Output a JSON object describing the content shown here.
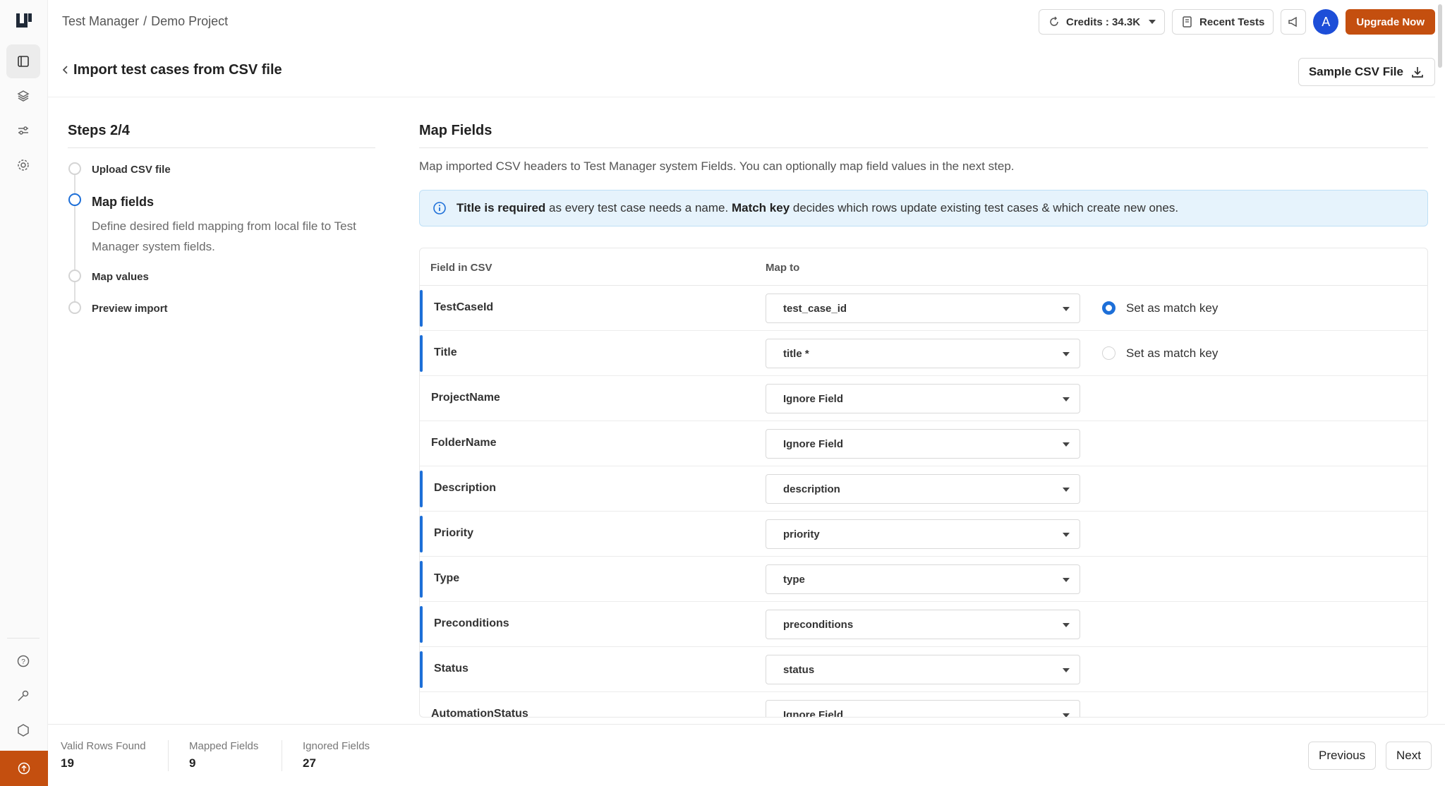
{
  "breadcrumb": {
    "app": "Test Manager",
    "separator": "/",
    "project": "Demo Project"
  },
  "topbar": {
    "credits": "Credits : 34.3K",
    "recent_tests": "Recent Tests",
    "avatar_initial": "A",
    "upgrade": "Upgrade Now"
  },
  "page": {
    "title": "Import test cases from CSV file",
    "sample_button": "Sample CSV File"
  },
  "steps": {
    "title": "Steps 2/4",
    "items": [
      {
        "label": "Upload CSV file"
      },
      {
        "label": "Map fields",
        "description": "Define desired field mapping from local file to Test Manager system fields."
      },
      {
        "label": "Map values"
      },
      {
        "label": "Preview import"
      }
    ]
  },
  "map": {
    "title": "Map Fields",
    "description": "Map imported CSV headers to Test Manager system Fields. You can optionally map field values in the next step.",
    "info": {
      "bold1": "Title is required",
      "text1": "as every test case needs a name.",
      "bold2": "Match key",
      "text2": "decides which rows update existing test cases & which create new ones."
    },
    "headers": {
      "field": "Field in CSV",
      "map_to": "Map to"
    },
    "match_key_label": "Set as match key",
    "rows": [
      {
        "field": "TestCaseId",
        "map_to": "test_case_id"
      },
      {
        "field": "Title",
        "map_to": "title *"
      },
      {
        "field": "ProjectName",
        "map_to": "Ignore Field"
      },
      {
        "field": "FolderName",
        "map_to": "Ignore Field"
      },
      {
        "field": "Description",
        "map_to": "description"
      },
      {
        "field": "Priority",
        "map_to": "priority"
      },
      {
        "field": "Type",
        "map_to": "type"
      },
      {
        "field": "Preconditions",
        "map_to": "preconditions"
      },
      {
        "field": "Status",
        "map_to": "status"
      },
      {
        "field": "AutomationStatus",
        "map_to": "Ignore Field"
      }
    ]
  },
  "footer": {
    "valid_rows_label": "Valid Rows Found",
    "valid_rows": "19",
    "mapped_label": "Mapped Fields",
    "mapped": "9",
    "ignored_label": "Ignored Fields",
    "ignored": "27",
    "previous": "Previous",
    "next": "Next"
  },
  "colors": {
    "accent": "#1d6fd8",
    "brand": "#c44f0f",
    "info_bg": "#e6f3fc"
  }
}
